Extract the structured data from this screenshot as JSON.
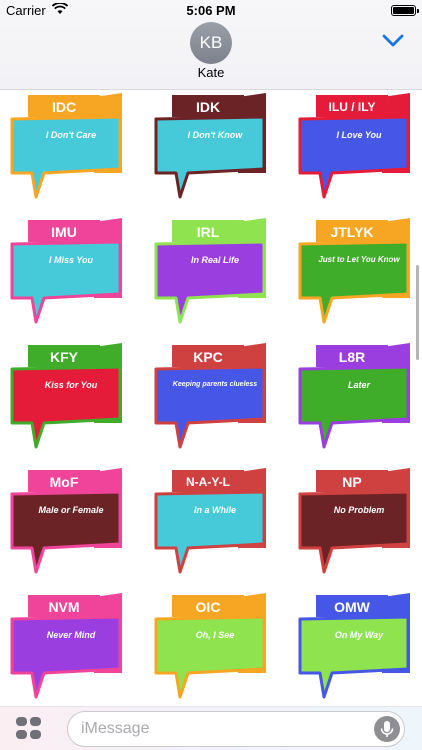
{
  "status": {
    "carrier": "Carrier",
    "time": "5:06 PM",
    "battery": 1.0
  },
  "header": {
    "avatar_initials": "KB",
    "contact_name": "Kate"
  },
  "compose": {
    "placeholder": "iMessage"
  },
  "icons": [
    "wifi-icon",
    "battery-icon",
    "chevron-down-icon",
    "apps-icon",
    "microphone-icon"
  ],
  "stickers": [
    {
      "abbr": "IDC",
      "meaning": "I Don't Care",
      "tab_color": "#f6a623",
      "body_color": "#46c9d9",
      "border_color": "#f6a623",
      "size": "normal"
    },
    {
      "abbr": "IDK",
      "meaning": "I Don't Know",
      "tab_color": "#6b2326",
      "body_color": "#46c9d9",
      "border_color": "#6b2326",
      "size": "normal"
    },
    {
      "abbr": "ILU / ILY",
      "meaning": "I Love You",
      "tab_color": "#e41c3a",
      "body_color": "#4656e6",
      "border_color": "#e41c3a",
      "size": "normal"
    },
    {
      "abbr": "IMU",
      "meaning": "I Miss You",
      "tab_color": "#f0449a",
      "body_color": "#46c9d9",
      "border_color": "#f0449a",
      "size": "normal"
    },
    {
      "abbr": "IRL",
      "meaning": "In Real Life",
      "tab_color": "#8ee34f",
      "body_color": "#9a3ee0",
      "border_color": "#8ee34f",
      "size": "normal"
    },
    {
      "abbr": "JTLYK",
      "meaning": "Just to Let You Know",
      "tab_color": "#f6a623",
      "body_color": "#3fac2a",
      "border_color": "#f6a623",
      "size": "mid"
    },
    {
      "abbr": "KFY",
      "meaning": "Kiss for You",
      "tab_color": "#3fac2a",
      "body_color": "#e41c3a",
      "border_color": "#3fac2a",
      "size": "normal"
    },
    {
      "abbr": "KPC",
      "meaning": "Keeping parents clueless",
      "tab_color": "#cf4040",
      "body_color": "#4656e6",
      "border_color": "#cf4040",
      "size": "small"
    },
    {
      "abbr": "L8R",
      "meaning": "Later",
      "tab_color": "#9a3ee0",
      "body_color": "#3fac2a",
      "border_color": "#9a3ee0",
      "size": "normal"
    },
    {
      "abbr": "MoF",
      "meaning": "Male or Female",
      "tab_color": "#f0449a",
      "body_color": "#6b2326",
      "border_color": "#f0449a",
      "size": "normal"
    },
    {
      "abbr": "N-A-Y-L",
      "meaning": "In a While",
      "tab_color": "#cf4040",
      "body_color": "#46c9d9",
      "border_color": "#cf4040",
      "size": "normal"
    },
    {
      "abbr": "NP",
      "meaning": "No Problem",
      "tab_color": "#cf4040",
      "body_color": "#6b2326",
      "border_color": "#cf4040",
      "size": "normal"
    },
    {
      "abbr": "NVM",
      "meaning": "Never Mind",
      "tab_color": "#f0449a",
      "body_color": "#9a3ee0",
      "border_color": "#f0449a",
      "size": "normal"
    },
    {
      "abbr": "OIC",
      "meaning": "Oh, I See",
      "tab_color": "#f6a623",
      "body_color": "#8ee34f",
      "border_color": "#f6a623",
      "size": "normal"
    },
    {
      "abbr": "OMW",
      "meaning": "On My Way",
      "tab_color": "#4656e6",
      "body_color": "#8ee34f",
      "border_color": "#4656e6",
      "size": "normal"
    }
  ]
}
